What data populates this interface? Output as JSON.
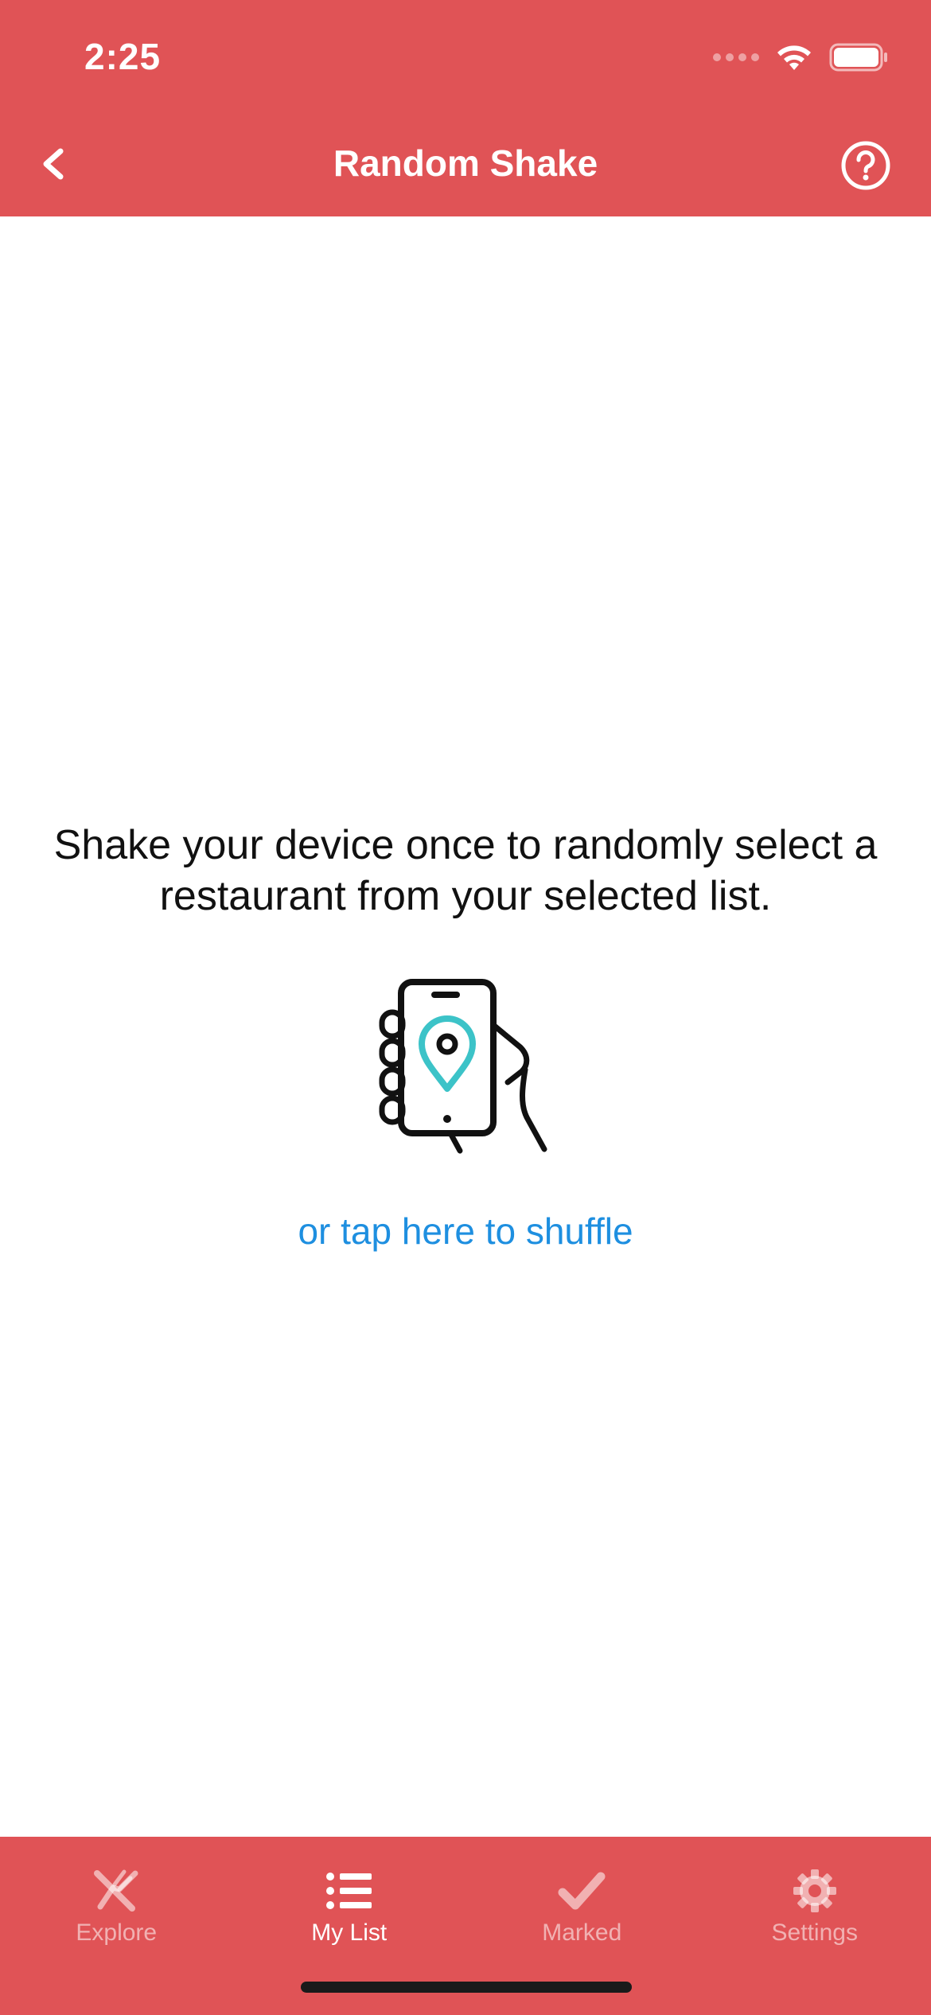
{
  "status_bar": {
    "time": "2:25"
  },
  "nav": {
    "title": "Random Shake"
  },
  "main": {
    "instructions": "Shake your device once to randomly select a restaurant from your selected list.",
    "shuffle_link": "or tap here to shuffle"
  },
  "tabs": [
    {
      "label": "Explore",
      "icon": "utensils-icon",
      "active": false
    },
    {
      "label": "My List",
      "icon": "list-icon",
      "active": true
    },
    {
      "label": "Marked",
      "icon": "checkmark-icon",
      "active": false
    },
    {
      "label": "Settings",
      "icon": "gear-icon",
      "active": false
    }
  ],
  "colors": {
    "brand": "#e05356",
    "link": "#1e8fe0",
    "pin": "#3cc3c8",
    "tab_inactive": "rgba(255,255,255,0.55)"
  }
}
